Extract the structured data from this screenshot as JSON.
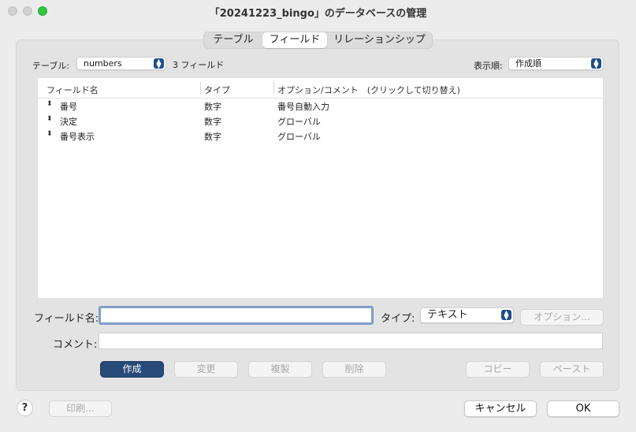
{
  "window": {
    "title": "「20241223_bingo」のデータベースの管理"
  },
  "tabs": [
    {
      "label": "テーブル"
    },
    {
      "label": "フィールド"
    },
    {
      "label": "リレーションシップ"
    }
  ],
  "table_selector": {
    "label": "テーブル:",
    "value": "numbers",
    "field_count": "3 フィールド"
  },
  "sort_selector": {
    "label": "表示順:",
    "value": "作成順"
  },
  "field_list": {
    "columns": [
      "フィールド名",
      "タイプ",
      "オプション/コメント　(クリックして切り替え)"
    ],
    "rows": [
      {
        "name": "番号",
        "type": "数字",
        "option": "番号自動入力"
      },
      {
        "name": "決定",
        "type": "数字",
        "option": "グローバル"
      },
      {
        "name": "番号表示",
        "type": "数字",
        "option": "グローバル"
      }
    ]
  },
  "form": {
    "field_name_label": "フィールド名:",
    "field_name_value": "",
    "type_label": "タイプ:",
    "type_value": "テキスト",
    "options_button": "オプション...",
    "comment_label": "コメント:",
    "comment_value": ""
  },
  "actions": {
    "create": "作成",
    "change": "変更",
    "duplicate": "複製",
    "delete": "削除",
    "copy": "コピー",
    "paste": "ペースト"
  },
  "footer": {
    "help": "?",
    "print": "印刷...",
    "cancel": "キャンセル",
    "ok": "OK"
  },
  "colors": {
    "accent": "#284a78",
    "focus_ring": "#7f9ec9",
    "zoom_button": "#2fc840"
  }
}
